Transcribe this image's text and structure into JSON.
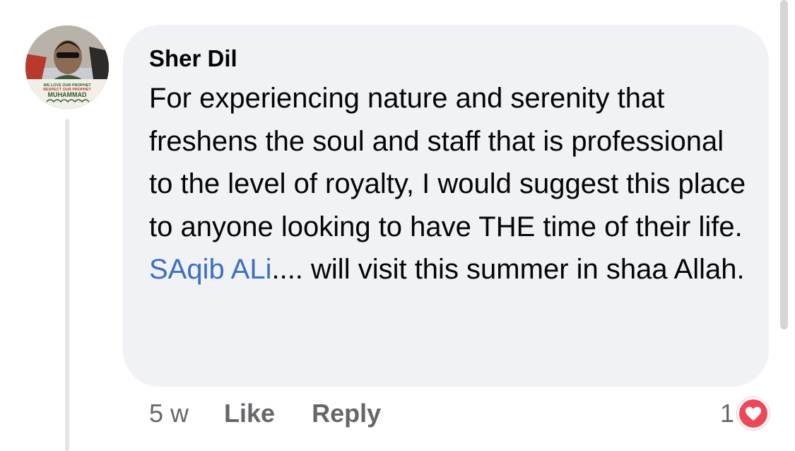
{
  "comment": {
    "author": "Sher Dil",
    "avatar_text": {
      "line1": "WE LOVE OUR PROPHET",
      "line2": "RESPECT OUR PROPHET",
      "line3": "MUHAMMAD"
    },
    "text_before_mention": "For experiencing nature and serenity that freshens the soul and staff that is professional to the level of royalty, I would suggest this place to anyone looking to have THE time of their life.",
    "mention": "SAqib ALi",
    "text_after_mention": ".... will visit this summer in shaa Allah."
  },
  "meta": {
    "time": "5 w",
    "like_label": "Like",
    "reply_label": "Reply"
  },
  "reactions": {
    "count": "1",
    "type_icon": "heart-icon",
    "badge_color": "#f04758"
  },
  "colors": {
    "bubble": "#f0f2f5",
    "mention": "#3b6fc4",
    "meta_text": "#65676b"
  }
}
